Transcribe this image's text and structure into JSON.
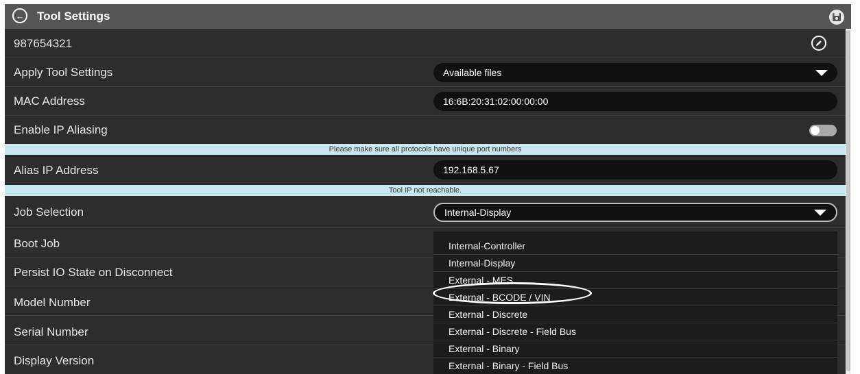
{
  "header": {
    "title": "Tool Settings",
    "back_icon": "arrow-left-circle-icon",
    "save_icon": "save-disk-icon"
  },
  "tool": {
    "name": "987654321",
    "edit_icon": "pencil-circle-icon"
  },
  "rows": {
    "apply_tool_settings": {
      "label": "Apply Tool Settings",
      "value": "Available files"
    },
    "mac_address": {
      "label": "MAC Address",
      "value": "16:6B:20:31:02:00:00:00"
    },
    "enable_ip_aliasing": {
      "label": "Enable IP Aliasing",
      "enabled": false
    },
    "alias_ip_address": {
      "label": "Alias IP Address",
      "value": "192.168.5.67"
    },
    "job_selection": {
      "label": "Job Selection",
      "value": "Internal-Display"
    },
    "boot_job": {
      "label": "Boot Job"
    },
    "persist_io": {
      "label": "Persist IO State on Disconnect"
    },
    "model_number": {
      "label": "Model Number"
    },
    "serial_number": {
      "label": "Serial Number"
    },
    "display_version": {
      "label": "Display Version"
    }
  },
  "notices": {
    "ports": "Please make sure all protocols have unique port numbers",
    "unreachable": "Tool IP not reachable."
  },
  "job_dropdown": {
    "options": [
      "Internal-Controller",
      "Internal-Display",
      "External - MES",
      "External - BCODE / VIN",
      "External - Discrete",
      "External - Discrete - Field Bus",
      "External - Binary",
      "External - Binary - Field Bus"
    ],
    "highlighted": "External - BCODE / VIN"
  },
  "colors": {
    "background": "#2d2d2d",
    "titlebar": "#555555",
    "notice_bg": "#c8e7f0",
    "field_bg": "#111111"
  }
}
